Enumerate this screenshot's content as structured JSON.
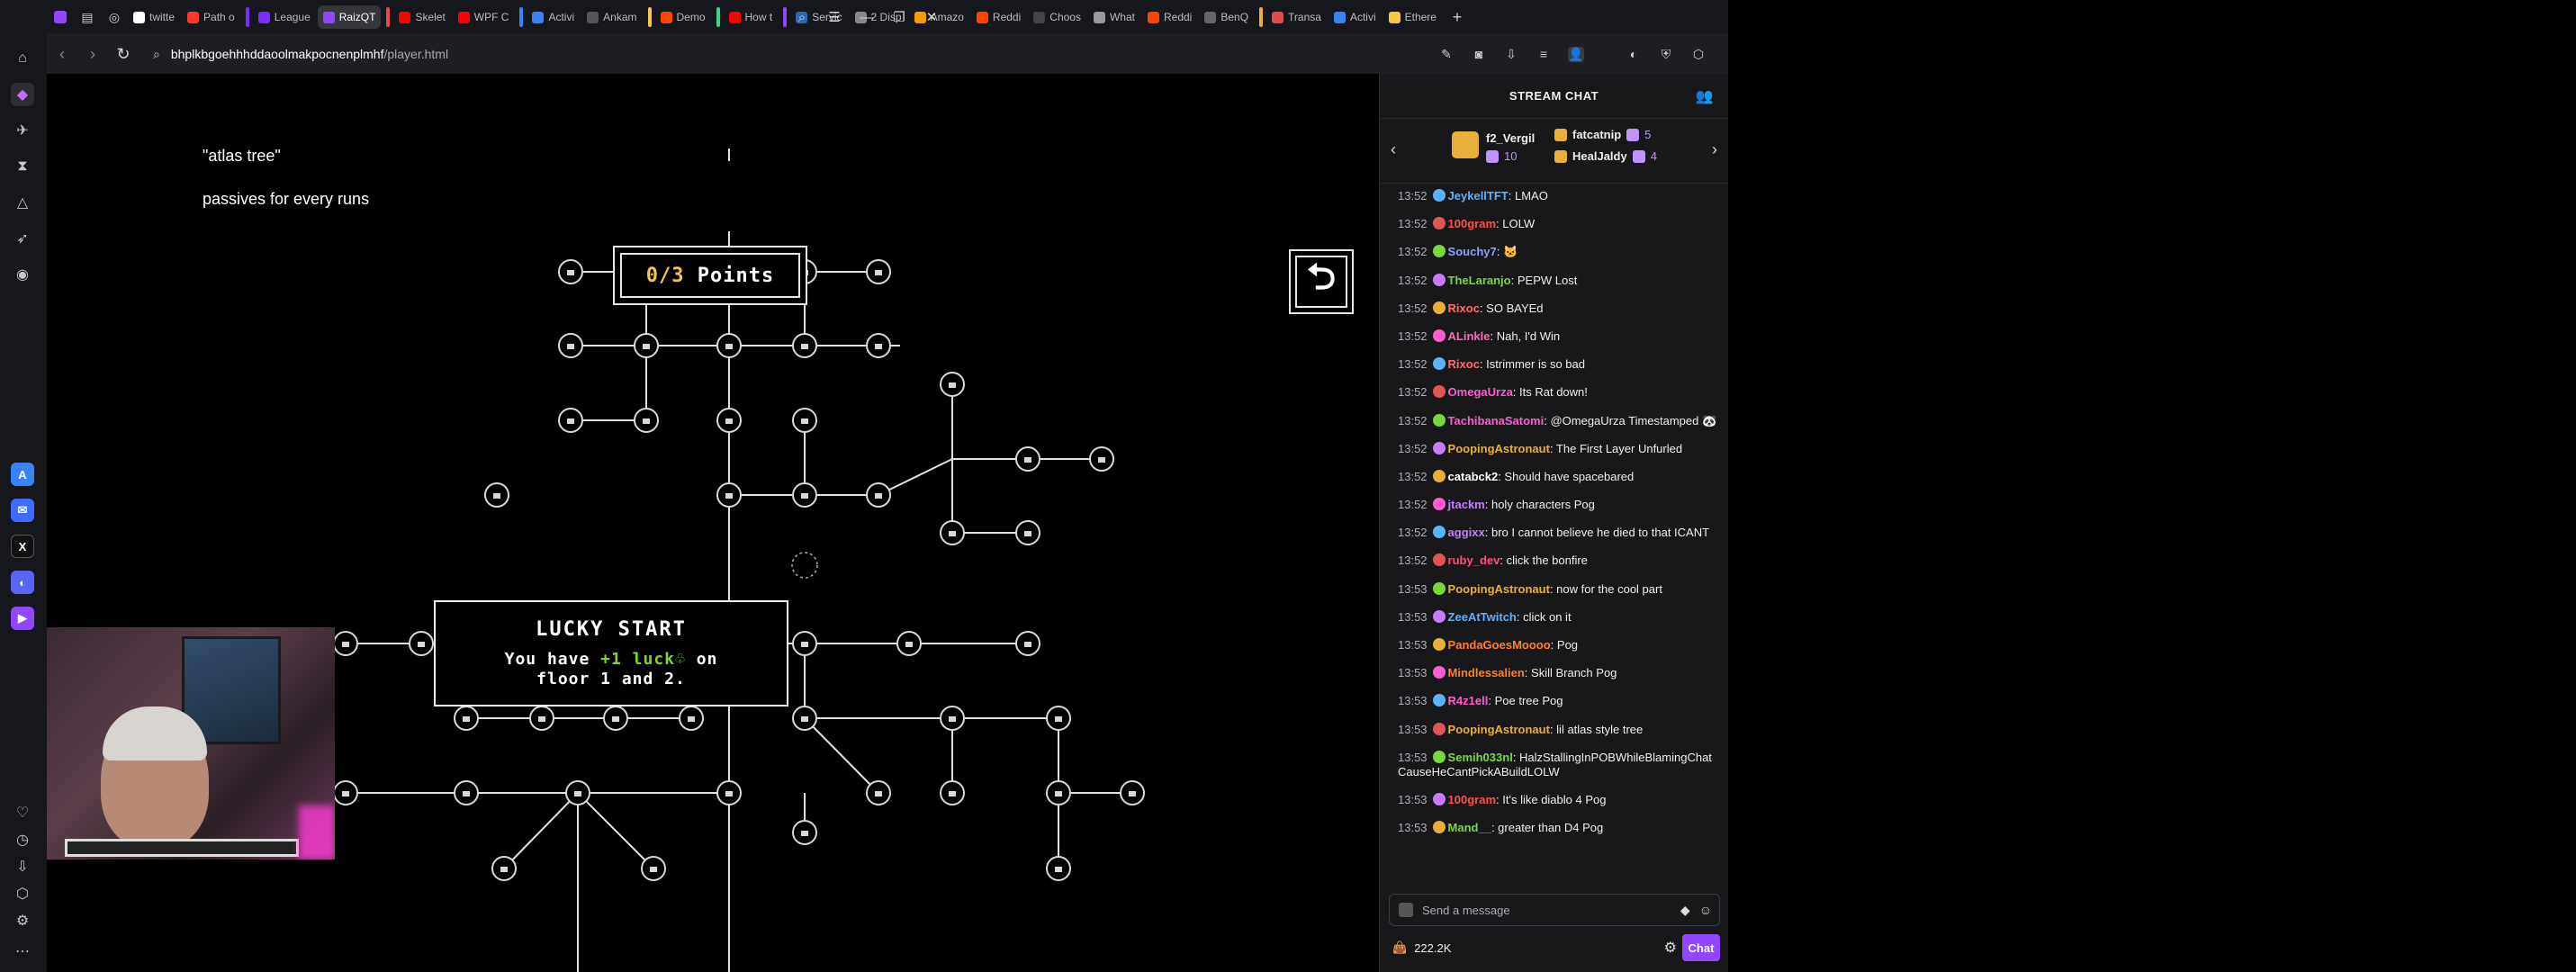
{
  "browser": {
    "tabs": [
      {
        "label": "twitte",
        "color": "#ffffff"
      },
      {
        "label": "Path o",
        "color": "#ff3b30"
      },
      {
        "label": "League",
        "color": "#7b2cff"
      },
      {
        "label": "RaizQT",
        "color": "#9147ff",
        "active": true
      },
      {
        "label": "Skelet",
        "color": "#ff0000"
      },
      {
        "label": "WPF C",
        "color": "#ff0000"
      },
      {
        "label": "Activi",
        "color": "#3b82f6"
      },
      {
        "label": "Ankam",
        "color": "#555555"
      },
      {
        "label": "Demo",
        "color": "#ff4500"
      },
      {
        "label": "How t",
        "color": "#ff0000"
      },
      {
        "label": "Servic",
        "color": "#2b6cb0"
      },
      {
        "label": "2 Disp",
        "color": "#888888"
      },
      {
        "label": "Amazo",
        "color": "#ff9900"
      },
      {
        "label": "Reddi",
        "color": "#ff4500"
      },
      {
        "label": "Choos",
        "color": "#444444"
      },
      {
        "label": "What",
        "color": "#999999"
      },
      {
        "label": "Reddi",
        "color": "#ff4500"
      },
      {
        "label": "BenQ",
        "color": "#666666"
      },
      {
        "label": "Transa",
        "color": "#e5484d"
      },
      {
        "label": "Activi",
        "color": "#3b82f6"
      },
      {
        "label": "Ethere",
        "color": "#f5c842"
      }
    ],
    "url_host": "bhplkbgoehhhddaoolmakpocnenplmhf",
    "url_path": "/player.html"
  },
  "game": {
    "caption1": "\"atlas tree\"",
    "caption2": "passives for every runs",
    "points_spent": "0",
    "points_total": "/3",
    "points_label": " Points",
    "tooltip_title": "LUCKY START",
    "tooltip_line1_pre": "You have ",
    "tooltip_line1_hl": "+1 luck",
    "tooltip_line1_post": " on",
    "tooltip_line2": "floor 1 and 2."
  },
  "chat": {
    "header": "STREAM CHAT",
    "gifters": [
      {
        "name": "f2_Vergil",
        "count": "10"
      },
      {
        "name": "fatcatnip",
        "count": "5"
      },
      {
        "name": "HealJaldy",
        "count": "4"
      }
    ],
    "messages": [
      {
        "ts": "13:52",
        "user": "JeykellTFT",
        "color": "#5ab4ff",
        "text": ": LMAO"
      },
      {
        "ts": "13:52",
        "user": "100gram",
        "color": "#ff4f4f",
        "text": ": LOLW"
      },
      {
        "ts": "13:52",
        "user": "Souchy7",
        "color": "#8aa0ff",
        "text": ": 🐱"
      },
      {
        "ts": "13:52",
        "user": "TheLaranjo",
        "color": "#7bd63a",
        "text": ": PEPW Lost"
      },
      {
        "ts": "13:52",
        "user": "Rixoc",
        "color": "#ff6b6b",
        "text": ": SO BAYEd"
      },
      {
        "ts": "13:52",
        "user": "ALinkle",
        "color": "#ff69b4",
        "text": ": Nah, I'd Win"
      },
      {
        "ts": "13:52",
        "user": "Rixoc",
        "color": "#ff6b6b",
        "text": ": Istrimmer is so bad"
      },
      {
        "ts": "13:52",
        "user": "OmegaUrza",
        "color": "#ff5ccf",
        "text": ": Its Rat down!"
      },
      {
        "ts": "13:52",
        "user": "TachibanaSatomi",
        "color": "#ff5ccf",
        "text": ": @OmegaUrza Timestamped 🐼"
      },
      {
        "ts": "13:52",
        "user": "PoopingAstronaut",
        "color": "#e8b03a",
        "text": ": The First Layer Unfurled"
      },
      {
        "ts": "13:52",
        "user": "catabck2",
        "color": "#ffffff",
        "text": ": Should have spacebared"
      },
      {
        "ts": "13:52",
        "user": "jtackm",
        "color": "#c77dff",
        "text": ": holy characters Pog"
      },
      {
        "ts": "13:52",
        "user": "aggixx",
        "color": "#c77dff",
        "text": ": bro I cannot believe he died to that ICANT"
      },
      {
        "ts": "13:52",
        "user": "ruby_dev",
        "color": "#ff4f7b",
        "text": ": click the bonfire"
      },
      {
        "ts": "13:53",
        "user": "PoopingAstronaut",
        "color": "#e8b03a",
        "text": ": now for the cool part"
      },
      {
        "ts": "13:53",
        "user": "ZeeAtTwitch",
        "color": "#5ab4ff",
        "text": ": click on it"
      },
      {
        "ts": "13:53",
        "user": "PandaGoesMoooo",
        "color": "#ff7f2a",
        "text": ": Pog"
      },
      {
        "ts": "13:53",
        "user": "Mindlessalien",
        "color": "#ff7f2a",
        "text": ": Skill Branch Pog"
      },
      {
        "ts": "13:53",
        "user": "R4z1ell",
        "color": "#ff5ccf",
        "text": ": Poe tree Pog"
      },
      {
        "ts": "13:53",
        "user": "PoopingAstronaut",
        "color": "#e8b03a",
        "text": ": lil atlas style tree"
      },
      {
        "ts": "13:53",
        "user": "Semih033nl",
        "color": "#7bd63a",
        "text": ": HalzStallingInPOBWhileBlamingChatCauseHeCantPickABuildLOLW"
      },
      {
        "ts": "13:53",
        "user": "100gram",
        "color": "#ff4f4f",
        "text": ": It's like diablo 4 Pog"
      },
      {
        "ts": "13:53",
        "user": "Mand__",
        "color": "#7bd63a",
        "text": ": greater than D4 Pog"
      }
    ],
    "input_placeholder": "Send a message",
    "channel_points": "222.2K",
    "chat_button": "Chat"
  }
}
